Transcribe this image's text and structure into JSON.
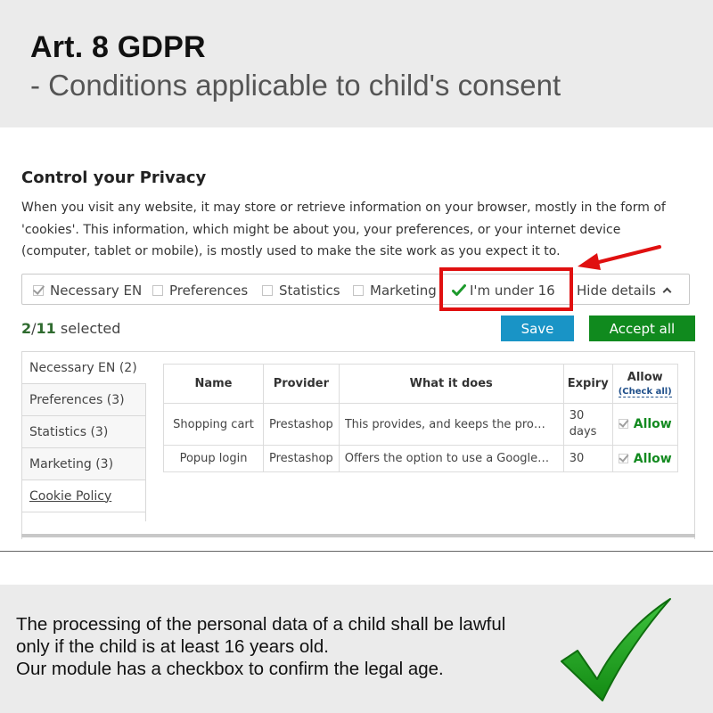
{
  "header": {
    "title": "Art. 8 GDPR",
    "subtitle": "- Conditions applicable to child's consent"
  },
  "panel": {
    "title": "Control your Privacy",
    "description": "When you visit any website, it may store or retrieve information on your browser, mostly in the form of 'cookies'. This information, which might be about you, your preferences, or your internet device (computer, tablet or mobile), is mostly used to make the site work as you expect it to."
  },
  "consent_options": {
    "necessary": {
      "label": "Necessary EN",
      "checked": true,
      "disabled": true
    },
    "preferences": {
      "label": "Preferences",
      "checked": false
    },
    "statistics": {
      "label": "Statistics",
      "checked": false
    },
    "marketing": {
      "label": "Marketing",
      "checked": false
    },
    "under16": {
      "label": "I'm under 16",
      "checked": true
    },
    "hide_details": "Hide details"
  },
  "selection": {
    "count": "2",
    "separator": "/",
    "total": "11",
    "suffix": "selected"
  },
  "buttons": {
    "save": "Save",
    "accept_all": "Accept all"
  },
  "categories": [
    {
      "label": "Necessary EN (2)"
    },
    {
      "label": "Preferences (3)"
    },
    {
      "label": "Statistics (3)"
    },
    {
      "label": "Marketing (3)"
    },
    {
      "label": "Cookie Policy"
    }
  ],
  "table": {
    "headers": {
      "name": "Name",
      "provider": "Provider",
      "what": "What it does",
      "expiry": "Expiry",
      "allow": "Allow",
      "check_all": "(Check all)"
    },
    "rows": [
      {
        "name": "Shopping cart",
        "provider": "Prestashop",
        "what": "This provides, and keeps the product...",
        "expiry": "30 days",
        "allow": "Allow"
      },
      {
        "name": "Popup login",
        "provider": "Prestashop",
        "what": "Offers the option to use a Google Pl...",
        "expiry": "30",
        "allow": "Allow"
      }
    ]
  },
  "footer": {
    "line1": "The processing of the personal data of a child shall be lawful",
    "line2": "only if the child is at least 16 years old.",
    "line3": "Our module has a checkbox to confirm the legal age."
  },
  "colors": {
    "save_button": "#1994c6",
    "accept_button": "#108a1e",
    "highlight_box": "#e01010",
    "allow_text": "#138a20",
    "band_background": "#ebebeb"
  },
  "icons": {
    "under16_check": "green-check-icon",
    "hide_details": "chevron-up-icon",
    "annotation": "red-arrow-icon",
    "footer": "big-green-checkmark-icon"
  }
}
